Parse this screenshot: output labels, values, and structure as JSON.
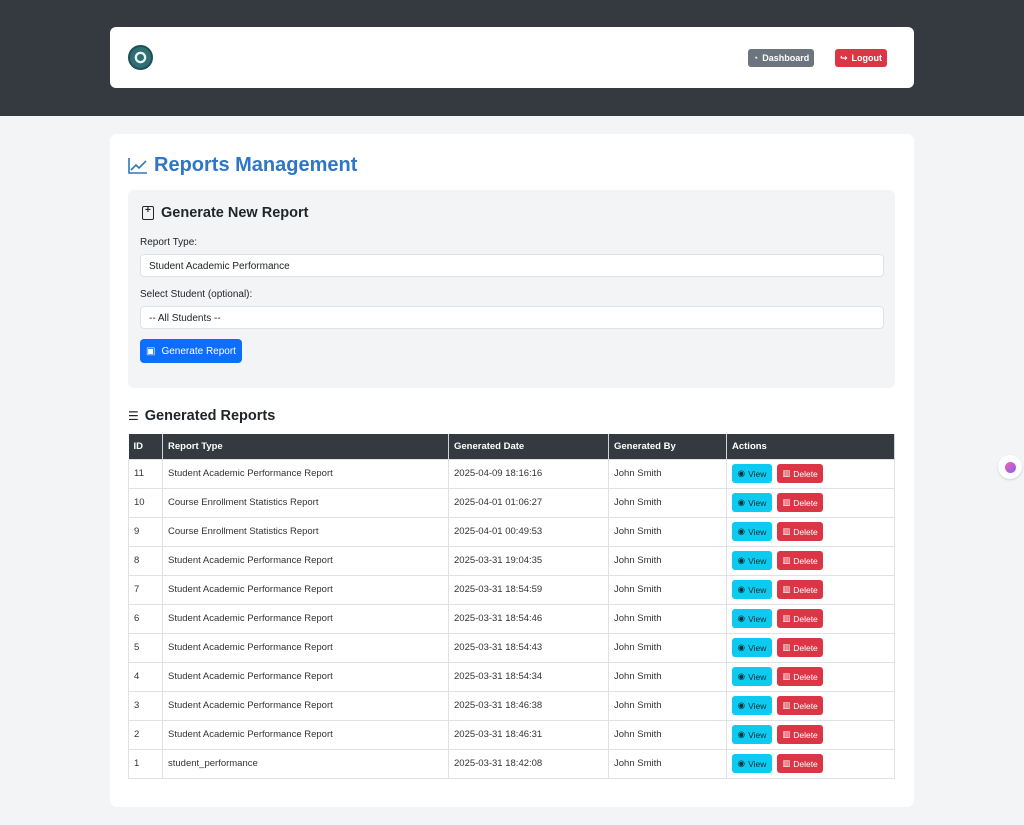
{
  "nav": {
    "logo_icon": "university-seal-icon",
    "dashboard_label": "Dashboard",
    "logout_label": "Logout"
  },
  "page": {
    "title": "Reports Management"
  },
  "generate": {
    "title": "Generate New Report",
    "report_type_label": "Report Type:",
    "report_type_value": "Student Academic Performance",
    "student_label": "Select Student (optional):",
    "student_value": "-- All Students --",
    "button_label": "Generate Report"
  },
  "reports": {
    "title": "Generated Reports",
    "columns": [
      "ID",
      "Report Type",
      "Generated Date",
      "Generated By",
      "Actions"
    ],
    "view_label": "View",
    "delete_label": "Delete",
    "rows": [
      {
        "id": "11",
        "type": "Student Academic Performance Report",
        "date": "2025-04-09 18:16:16",
        "by": "John Smith"
      },
      {
        "id": "10",
        "type": "Course Enrollment Statistics Report",
        "date": "2025-04-01 01:06:27",
        "by": "John Smith"
      },
      {
        "id": "9",
        "type": "Course Enrollment Statistics Report",
        "date": "2025-04-01 00:49:53",
        "by": "John Smith"
      },
      {
        "id": "8",
        "type": "Student Academic Performance Report",
        "date": "2025-03-31 19:04:35",
        "by": "John Smith"
      },
      {
        "id": "7",
        "type": "Student Academic Performance Report",
        "date": "2025-03-31 18:54:59",
        "by": "John Smith"
      },
      {
        "id": "6",
        "type": "Student Academic Performance Report",
        "date": "2025-03-31 18:54:46",
        "by": "John Smith"
      },
      {
        "id": "5",
        "type": "Student Academic Performance Report",
        "date": "2025-03-31 18:54:43",
        "by": "John Smith"
      },
      {
        "id": "4",
        "type": "Student Academic Performance Report",
        "date": "2025-03-31 18:54:34",
        "by": "John Smith"
      },
      {
        "id": "3",
        "type": "Student Academic Performance Report",
        "date": "2025-03-31 18:46:38",
        "by": "John Smith"
      },
      {
        "id": "2",
        "type": "Student Academic Performance Report",
        "date": "2025-03-31 18:46:31",
        "by": "John Smith"
      },
      {
        "id": "1",
        "type": "student_performance",
        "date": "2025-03-31 18:42:08",
        "by": "John Smith"
      }
    ]
  },
  "colors": {
    "primary": "#0d6efd",
    "dark": "#343a40",
    "danger": "#dc3545",
    "info": "#0dcaf0",
    "title_blue": "#2f76c6"
  }
}
